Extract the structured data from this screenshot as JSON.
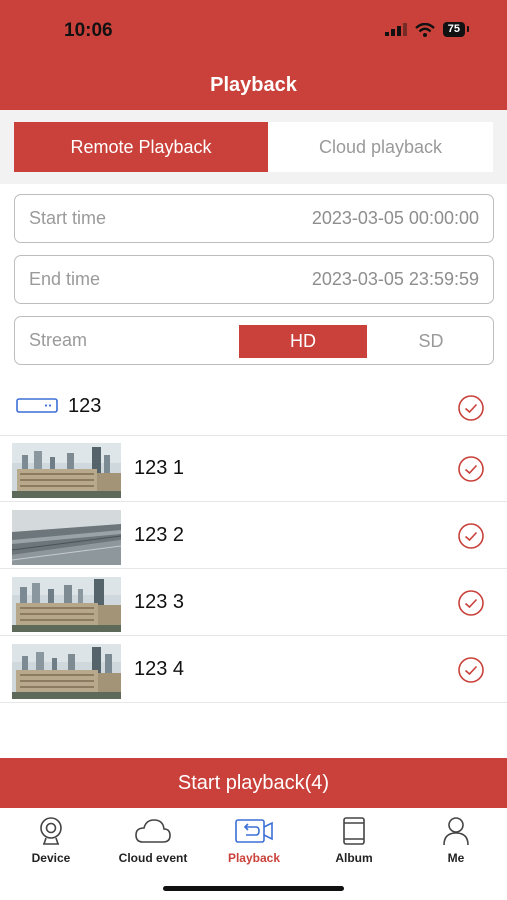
{
  "status_bar": {
    "time": "10:06",
    "battery": "75"
  },
  "header": {
    "title": "Playback"
  },
  "tabs": {
    "remote": "Remote Playback",
    "cloud": "Cloud playback"
  },
  "start_time": {
    "label": "Start time",
    "value": "2023-03-05 00:00:00"
  },
  "end_time": {
    "label": "End time",
    "value": "2023-03-05 23:59:59"
  },
  "stream": {
    "label": "Stream",
    "hd": "HD",
    "sd": "SD",
    "selected": "HD"
  },
  "device": {
    "name": "123",
    "checked": true
  },
  "cameras": [
    {
      "name": "123 1",
      "checked": true
    },
    {
      "name": "123 2",
      "checked": true
    },
    {
      "name": "123 3",
      "checked": true
    },
    {
      "name": "123 4",
      "checked": true
    }
  ],
  "start_button": "Start playback(4)",
  "tabbar": {
    "items": [
      {
        "label": "Device",
        "icon": "camera-icon"
      },
      {
        "label": "Cloud event",
        "icon": "cloud-icon"
      },
      {
        "label": "Playback",
        "icon": "playback-icon",
        "active": true
      },
      {
        "label": "Album",
        "icon": "tablet-icon"
      },
      {
        "label": "Me",
        "icon": "person-icon"
      }
    ]
  },
  "colors": {
    "accent": "#c9413a"
  }
}
